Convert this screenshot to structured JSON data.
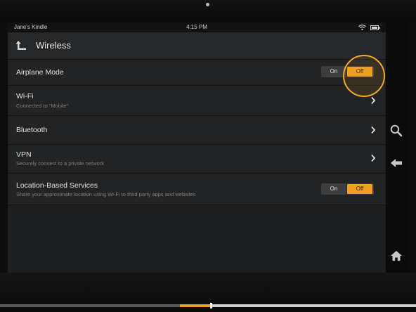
{
  "status_bar": {
    "device_name": "Jane's Kindle",
    "time": "4:15 PM",
    "icons": [
      "wifi-icon",
      "battery-icon"
    ]
  },
  "header": {
    "title": "Wireless",
    "back_icon": "back-up-arrow-icon"
  },
  "settings": {
    "airplane": {
      "title": "Airplane Mode",
      "on": "On",
      "off": "Off",
      "selected": "Off"
    },
    "wifi": {
      "title": "Wi-Fi",
      "subtitle": "Connected to \"Mobile\""
    },
    "bluetooth": {
      "title": "Bluetooth"
    },
    "vpn": {
      "title": "VPN",
      "subtitle": "Securely connect to a private network"
    },
    "location": {
      "title": "Location-Based Services",
      "subtitle": "Share your approximate location using Wi-Fi to third party apps and websites",
      "on": "On",
      "off": "Off",
      "selected": "Off"
    }
  },
  "side_nav": {
    "icons": [
      "search-icon",
      "back-arrow-icon",
      "home-icon"
    ]
  },
  "colors": {
    "accent": "#f0a020",
    "background": "#1e1f20",
    "text": "#e2e2e2",
    "subtext": "#7f7f7f"
  },
  "video_progress": {
    "played_fraction": 0.51
  }
}
